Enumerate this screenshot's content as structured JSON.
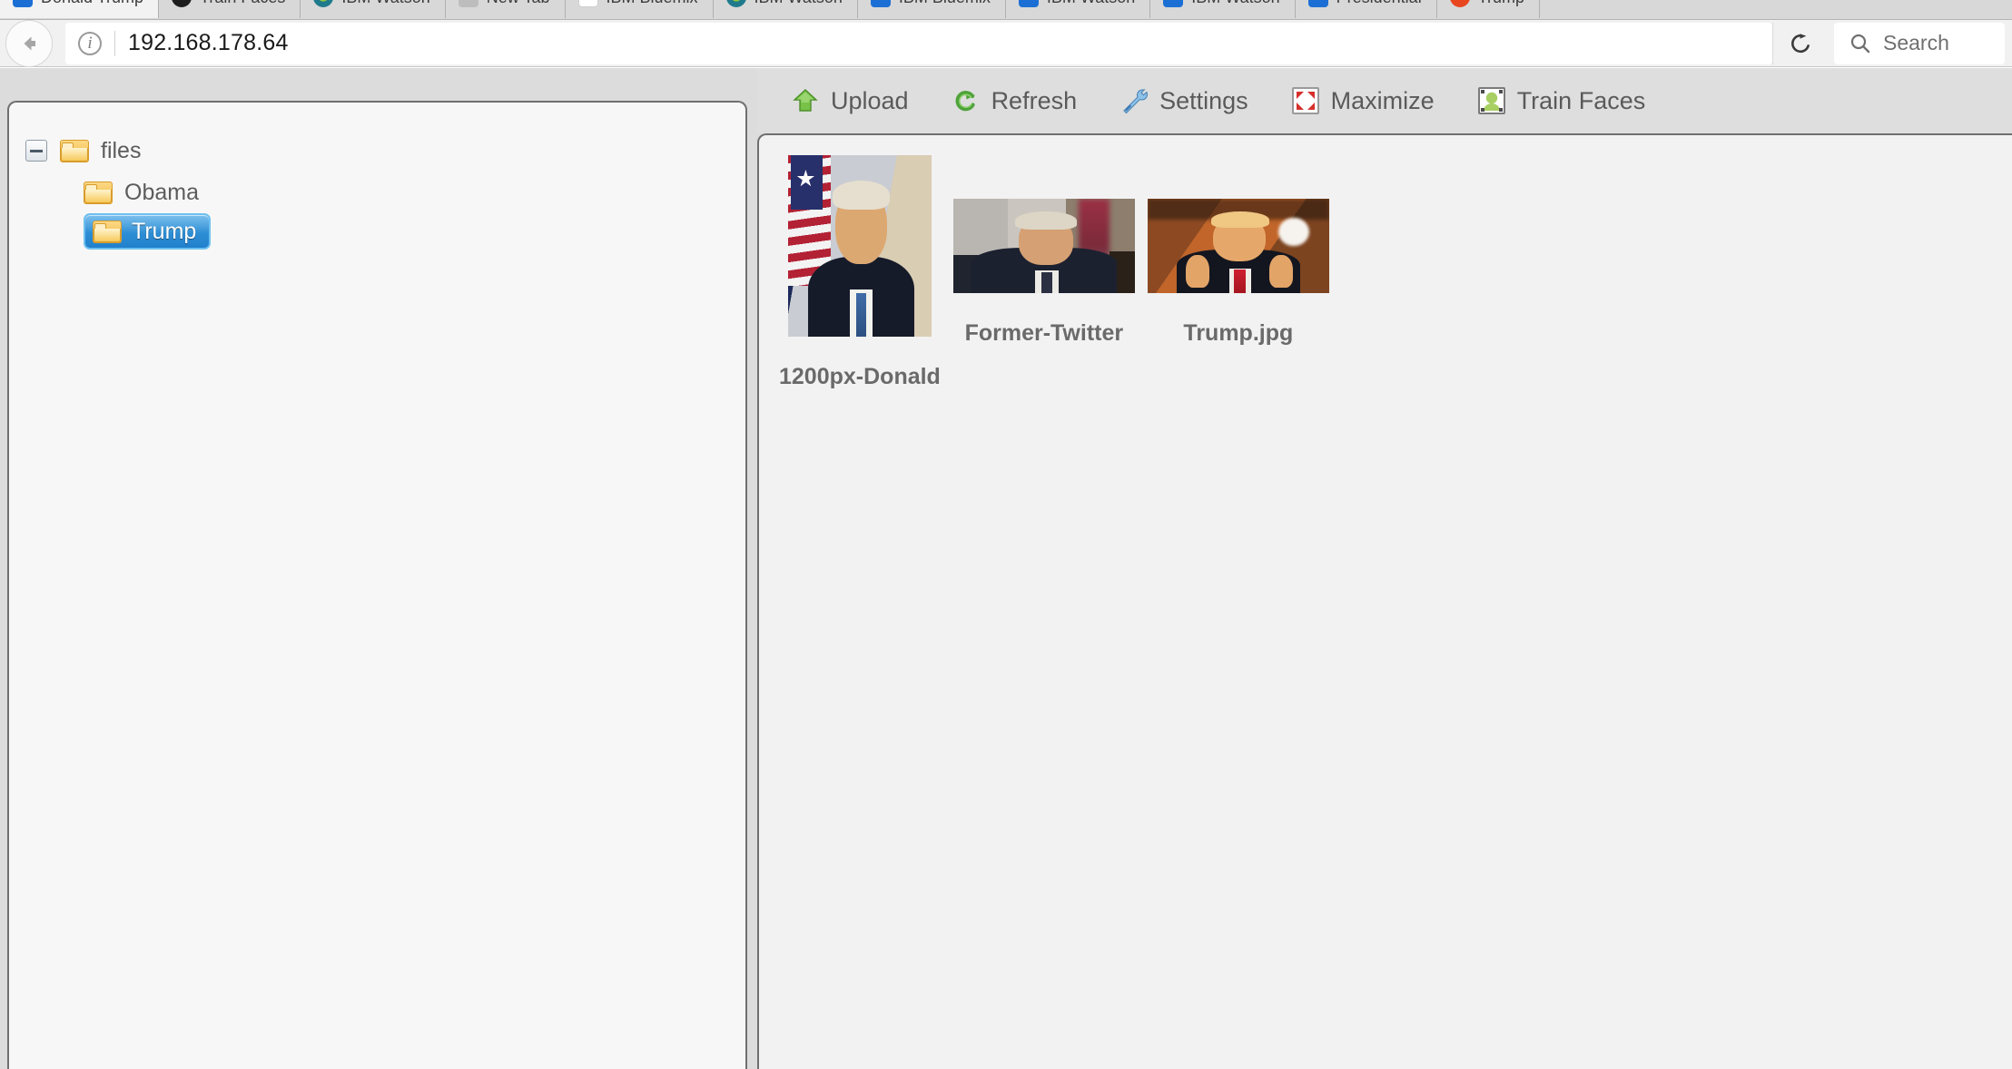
{
  "browser": {
    "tabs": [
      {
        "label": "Donald Trump",
        "favicon": "favicon-blue"
      },
      {
        "label": "Train Faces",
        "favicon": "favicon-black"
      },
      {
        "label": "IBM Watson",
        "favicon": "favicon-teal"
      },
      {
        "label": "New Tab",
        "favicon": "favicon-gray"
      },
      {
        "label": "IBM Bluemix",
        "favicon": "favicon-white"
      },
      {
        "label": "IBM Watson",
        "favicon": "favicon-teal"
      },
      {
        "label": "IBM Bluemix",
        "favicon": "favicon-blue"
      },
      {
        "label": "IBM Watson",
        "favicon": "favicon-blue"
      },
      {
        "label": "IBM Watson",
        "favicon": "favicon-blue"
      },
      {
        "label": "Presidential",
        "favicon": "favicon-blue"
      },
      {
        "label": "Trump",
        "favicon": "favicon-orange"
      }
    ],
    "back_icon": "back-arrow-icon",
    "info_icon": "info-icon",
    "info_glyph": "i",
    "url": "192.168.178.64",
    "reload_icon": "reload-icon",
    "search": {
      "icon": "search-icon",
      "placeholder": "Search"
    }
  },
  "sidebar": {
    "root": {
      "label": "files",
      "twisty": "collapse-minus-icon",
      "folder_icon": "folder-icon"
    },
    "children": [
      {
        "label": "Obama",
        "folder_icon": "folder-icon",
        "selected": false
      },
      {
        "label": "Trump",
        "folder_icon": "folder-icon",
        "selected": true
      }
    ]
  },
  "toolbar": {
    "buttons": [
      {
        "label": "Upload",
        "icon": "upload-arrow-icon"
      },
      {
        "label": "Refresh",
        "icon": "refresh-circular-arrow-icon"
      },
      {
        "label": "Settings",
        "icon": "wrench-icon"
      },
      {
        "label": "Maximize",
        "icon": "maximize-arrows-icon"
      },
      {
        "label": "Train Faces",
        "icon": "face-frame-icon"
      }
    ]
  },
  "gallery": {
    "items": [
      {
        "caption": "1200px-Donald",
        "orientation": "portrait",
        "alt": "portrait-photo-flag-background"
      },
      {
        "caption": "Former-Twitter",
        "orientation": "landscape",
        "alt": "seated-portrait-photo"
      },
      {
        "caption": "Trump.jpg",
        "orientation": "landscape",
        "alt": "thumbs-up-photo"
      }
    ]
  },
  "colors": {
    "selection_blue": "#2e8ed4",
    "folder_yellow": "#f0b73f",
    "accent_green": "#72ba4a",
    "toolbar_bg": "#dedede",
    "panel_bg": "#f2f2f2",
    "sidebar_bg": "#f7f7f7",
    "text_gray": "#5a5a5a"
  }
}
